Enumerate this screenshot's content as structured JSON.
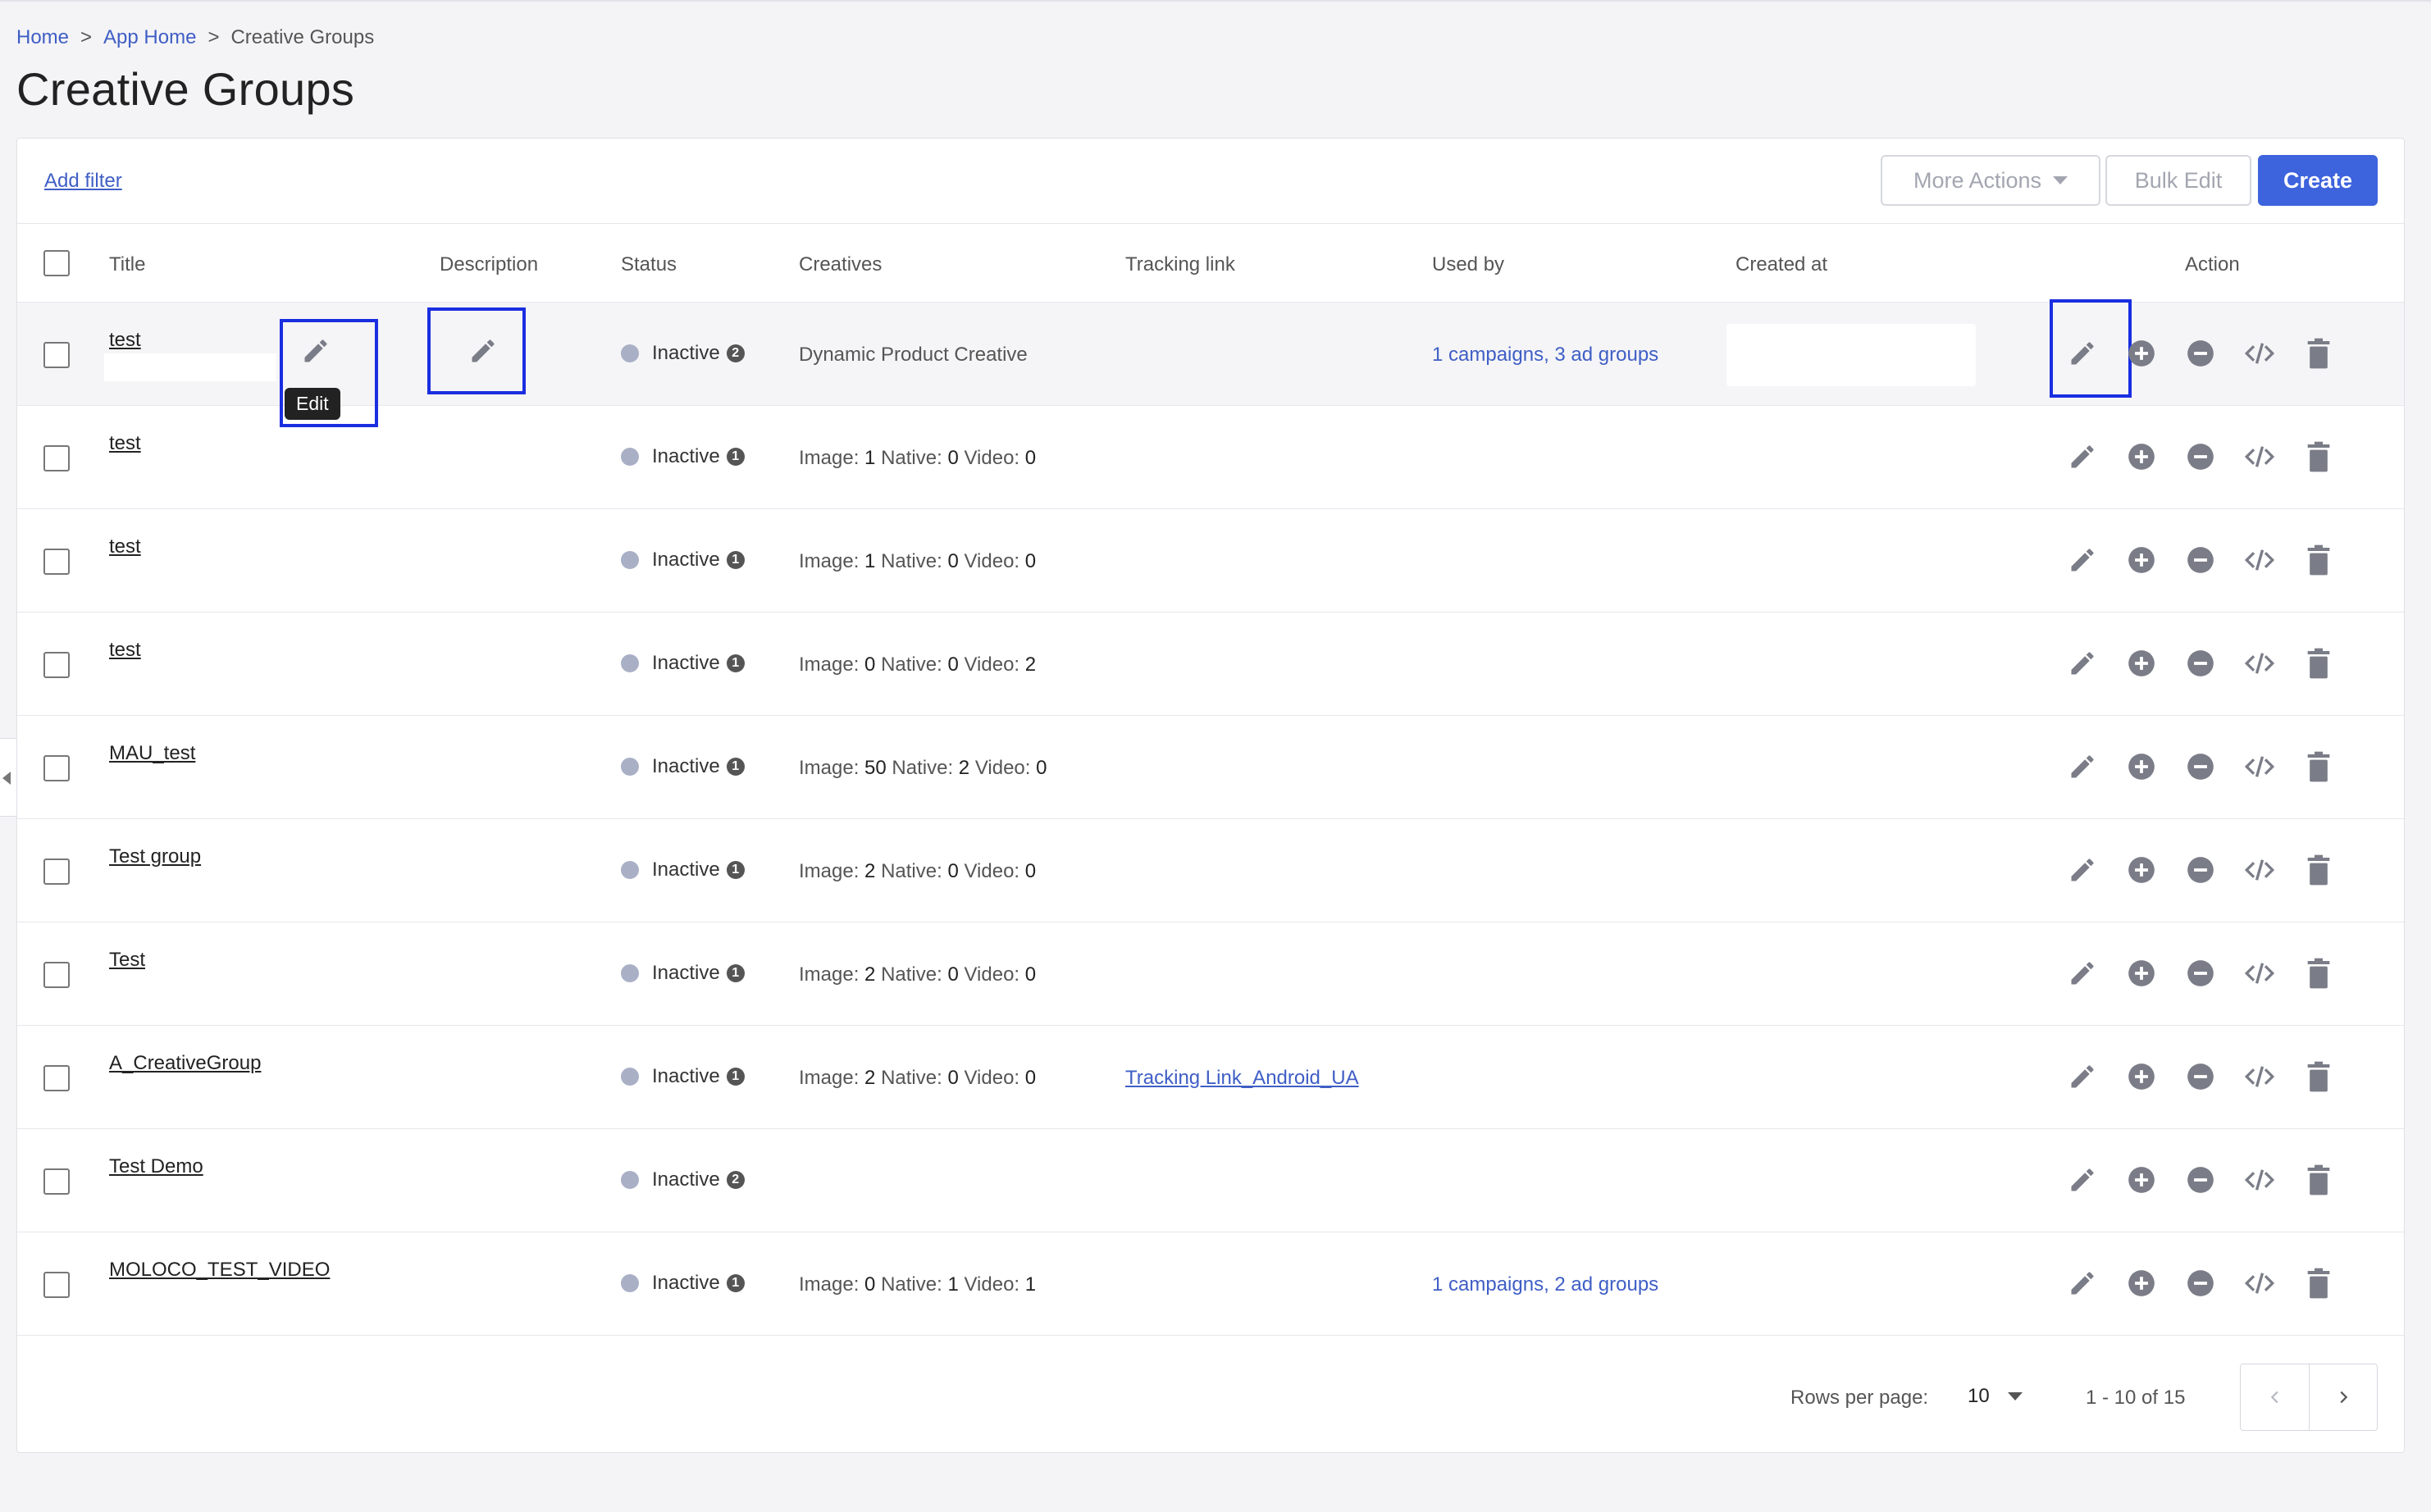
{
  "breadcrumb": {
    "home": "Home",
    "app_home": "App Home",
    "current": "Creative Groups",
    "separator": ">"
  },
  "page": {
    "title": "Creative Groups"
  },
  "toolbar": {
    "add_filter": "Add filter",
    "more_actions": "More Actions",
    "bulk_edit": "Bulk Edit",
    "create": "Create"
  },
  "table": {
    "headers": {
      "title": "Title",
      "description": "Description",
      "status": "Status",
      "creatives": "Creatives",
      "tracking": "Tracking link",
      "used_by": "Used by",
      "created_at": "Created at",
      "action": "Action"
    },
    "rows": [
      {
        "title": "test",
        "status": "Inactive",
        "count": "2",
        "creatives": "Dynamic Product Creative",
        "tracking": "",
        "used_by": "1 campaigns, 3 ad groups"
      },
      {
        "title": "test",
        "status": "Inactive",
        "count": "1",
        "creatives": {
          "image": "1",
          "native": "0",
          "video": "0"
        },
        "tracking": "",
        "used_by": ""
      },
      {
        "title": "test",
        "status": "Inactive",
        "count": "1",
        "creatives": {
          "image": "1",
          "native": "0",
          "video": "0"
        },
        "tracking": "",
        "used_by": ""
      },
      {
        "title": "test",
        "status": "Inactive",
        "count": "1",
        "creatives": {
          "image": "0",
          "native": "0",
          "video": "2"
        },
        "tracking": "",
        "used_by": ""
      },
      {
        "title": "MAU_test",
        "status": "Inactive",
        "count": "1",
        "creatives": {
          "image": "50",
          "native": "2",
          "video": "0"
        },
        "tracking": "",
        "used_by": ""
      },
      {
        "title": "Test group",
        "status": "Inactive",
        "count": "1",
        "creatives": {
          "image": "2",
          "native": "0",
          "video": "0"
        },
        "tracking": "",
        "used_by": ""
      },
      {
        "title": "Test",
        "status": "Inactive",
        "count": "1",
        "creatives": {
          "image": "2",
          "native": "0",
          "video": "0"
        },
        "tracking": "",
        "used_by": ""
      },
      {
        "title": "A_CreativeGroup",
        "status": "Inactive",
        "count": "1",
        "creatives": {
          "image": "2",
          "native": "0",
          "video": "0"
        },
        "tracking": "Tracking Link_Android_UA",
        "used_by": ""
      },
      {
        "title": "Test Demo",
        "status": "Inactive",
        "count": "2",
        "creatives": "",
        "tracking": "",
        "used_by": ""
      },
      {
        "title": "MOLOCO_TEST_VIDEO",
        "status": "Inactive",
        "count": "1",
        "creatives": {
          "image": "0",
          "native": "1",
          "video": "1"
        },
        "tracking": "",
        "used_by": "1 campaigns, 2 ad groups"
      }
    ],
    "creative_labels": {
      "image": "Image:",
      "native": "Native:",
      "video": "Video:"
    }
  },
  "tooltip": {
    "edit": "Edit"
  },
  "pagination": {
    "rows_per_page_label": "Rows per page:",
    "rows_per_page": "10",
    "range": "1 - 10 of 15"
  },
  "icons": [
    "pencil-icon",
    "plus-circle-icon",
    "minus-circle-icon",
    "code-icon",
    "trash-icon",
    "chevron-left-icon",
    "chevron-right-icon",
    "caret-down-icon"
  ],
  "colors": {
    "accent": "#3d63dd",
    "link": "#3f5ec5",
    "highlight": "#1a2ee0",
    "status_dot": "#a9b0c6",
    "icon": "#7a7d87"
  }
}
